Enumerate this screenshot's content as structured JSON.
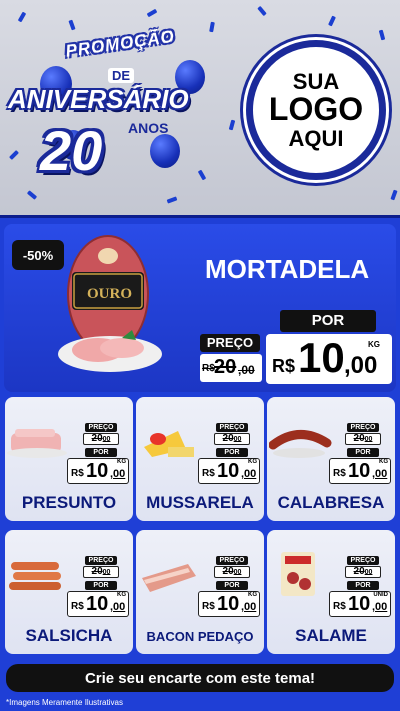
{
  "header": {
    "promo_top": "PROMOÇÃO",
    "promo_de": "DE",
    "promo_main": "ANIVERSÁRIO",
    "promo_number": "20",
    "promo_anos": "ANOS",
    "logo_line1": "SUA",
    "logo_line2": "LOGO",
    "logo_line3": "AQUI"
  },
  "featured": {
    "discount": "-50%",
    "brand": "OURO",
    "name": "MORTADELA",
    "preco_label": "PREÇO",
    "por_label": "POR",
    "old_currency": "R$",
    "old_int": "20",
    "old_cents": ",00",
    "new_currency": "R$",
    "new_int": "10",
    "new_cents": ",00",
    "unit": "KG"
  },
  "products": [
    {
      "name": "PRESUNTO",
      "preco_label": "PREÇO",
      "old": "20",
      "old_cents": "00",
      "por_label": "POR",
      "currency": "R$",
      "price": "10",
      "cents": ",00",
      "unit": "KG"
    },
    {
      "name": "MUSSARELA",
      "preco_label": "PREÇO",
      "old": "20",
      "old_cents": "00",
      "por_label": "POR",
      "currency": "R$",
      "price": "10",
      "cents": ",00",
      "unit": "KG"
    },
    {
      "name": "CALABRESA",
      "preco_label": "PREÇO",
      "old": "20",
      "old_cents": "00",
      "por_label": "POR",
      "currency": "R$",
      "price": "10",
      "cents": ",00",
      "unit": "KG"
    },
    {
      "name": "SALSICHA",
      "preco_label": "PREÇO",
      "old": "20",
      "old_cents": "00",
      "por_label": "POR",
      "currency": "R$",
      "price": "10",
      "cents": ",00",
      "unit": "KG"
    },
    {
      "name": "BACON PEDAÇO",
      "preco_label": "PREÇO",
      "old": "20",
      "old_cents": "00",
      "por_label": "POR",
      "currency": "R$",
      "price": "10",
      "cents": ",00",
      "unit": "KG"
    },
    {
      "name": "SALAME",
      "preco_label": "PREÇO",
      "old": "20",
      "old_cents": "00",
      "por_label": "POR",
      "currency": "R$",
      "price": "10",
      "cents": ",00",
      "unit": "UNID"
    }
  ],
  "footer": {
    "cta": "Crie seu encarte com este tema!",
    "disclaimer": "*Imagens Meramente Ilustrativas"
  },
  "colors": {
    "primary_blue": "#1f3fd6",
    "dark_blue": "#1b2a9a",
    "label_black": "#111111"
  }
}
